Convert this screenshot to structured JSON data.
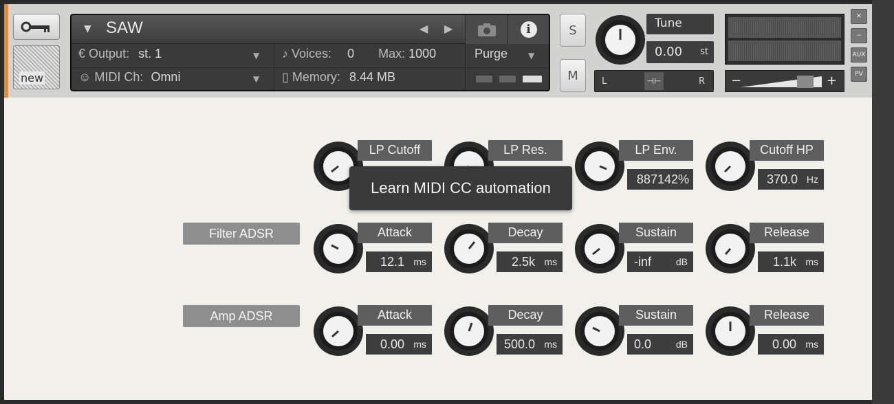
{
  "instrument": {
    "name": "SAW",
    "output_label": "Output:",
    "output_value": "st. 1",
    "midi_label": "MIDI Ch:",
    "midi_value": "Omni",
    "voices_label": "Voices:",
    "voices_value": "0",
    "max_label": "Max:",
    "max_value": "1000",
    "memory_label": "Memory:",
    "memory_value": "8.44 MB",
    "purge_label": "Purge"
  },
  "badge": {
    "new_label": "new"
  },
  "solo_label": "S",
  "mute_label": "M",
  "tune": {
    "label": "Tune",
    "value": "0.00",
    "unit": "st"
  },
  "pan": {
    "left": "L",
    "right": "R"
  },
  "volume": {
    "minus": "−",
    "plus": "+"
  },
  "side_buttons": {
    "close": "✕",
    "minimize": "−",
    "aux": "AUX",
    "pv": "PV"
  },
  "tooltip": "Learn MIDI CC automation",
  "filter_row": [
    {
      "label": "LP Cutoff",
      "value": "",
      "unit": ""
    },
    {
      "label": "LP Res.",
      "value": "",
      "unit": ""
    },
    {
      "label": "LP Env.",
      "value": "887142%",
      "unit": ""
    },
    {
      "label": "Cutoff HP",
      "value": "370.0",
      "unit": "Hz"
    }
  ],
  "filter_adsr": {
    "section": "Filter ADSR",
    "knobs": [
      {
        "label": "Attack",
        "value": "12.1",
        "unit": "ms"
      },
      {
        "label": "Decay",
        "value": "2.5k",
        "unit": "ms"
      },
      {
        "label": "Sustain",
        "value": "-inf",
        "unit": "dB"
      },
      {
        "label": "Release",
        "value": "1.1k",
        "unit": "ms"
      }
    ]
  },
  "amp_adsr": {
    "section": "Amp ADSR",
    "knobs": [
      {
        "label": "Attack",
        "value": "0.00",
        "unit": "ms"
      },
      {
        "label": "Decay",
        "value": "500.0",
        "unit": "ms"
      },
      {
        "label": "Sustain",
        "value": "0.0",
        "unit": "dB"
      },
      {
        "label": "Release",
        "value": "0.00",
        "unit": "ms"
      }
    ]
  }
}
